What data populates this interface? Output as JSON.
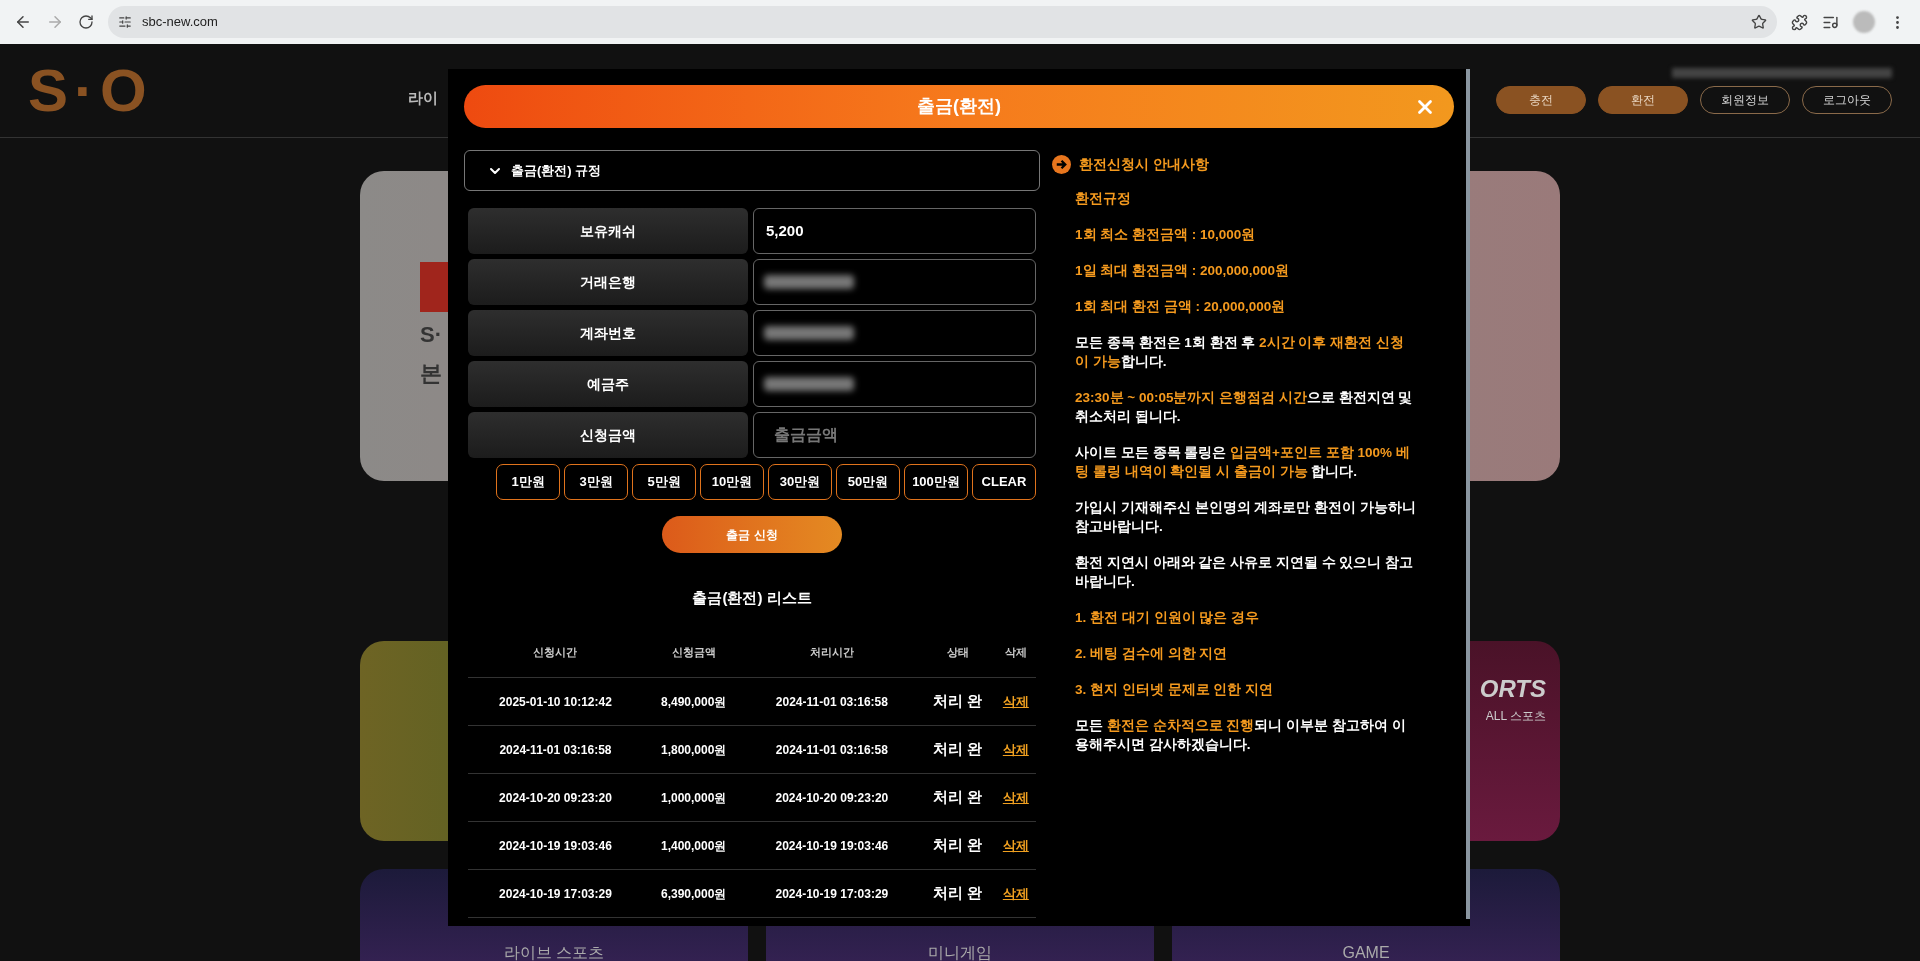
{
  "browser": {
    "url": "sbc-new.com"
  },
  "site": {
    "logo": "S·O",
    "nav_item": "라이",
    "header_buttons": [
      {
        "label": "충전",
        "kind": "filled"
      },
      {
        "label": "환전",
        "kind": "filled"
      },
      {
        "label": "회원정보",
        "kind": "outline"
      },
      {
        "label": "로그아웃",
        "kind": "outline"
      }
    ],
    "hero": {
      "line_1": "S·",
      "line_2": "본"
    },
    "cards": [
      {
        "title": "ORTS",
        "subtitle": "ALL 스포츠"
      }
    ],
    "bottom_cards": [
      {
        "title": "라이브 스포츠"
      },
      {
        "title": "미니게임"
      },
      {
        "title": "GAME"
      }
    ]
  },
  "modal": {
    "title": "출금(환전)",
    "accordion": {
      "label": "출금(환전) 규정",
      "expanded": false
    },
    "fields": [
      {
        "label": "보유캐쉬",
        "kind": "text",
        "value": "5,200"
      },
      {
        "label": "거래은행",
        "kind": "redacted"
      },
      {
        "label": "계좌번호",
        "kind": "redacted"
      },
      {
        "label": "예금주",
        "kind": "redacted"
      },
      {
        "label": "신청금액",
        "kind": "input",
        "placeholder": "출금금액"
      }
    ],
    "amount_buttons": [
      "1만원",
      "3만원",
      "5만원",
      "10만원",
      "30만원",
      "50만원",
      "100만원",
      "CLEAR"
    ],
    "submit": "출금 신청",
    "list_title": "출금(환전) 리스트",
    "table": {
      "columns": [
        "신청시간",
        "신청금액",
        "처리시간",
        "상태",
        "삭제"
      ],
      "rows": [
        {
          "requested": "2025-01-10 10:12:42",
          "amount": "8,490,000원",
          "processed": "2024-11-01 03:16:58",
          "status": "처리 완",
          "action": "삭제"
        },
        {
          "requested": "2024-11-01 03:16:58",
          "amount": "1,800,000원",
          "processed": "2024-11-01 03:16:58",
          "status": "처리 완",
          "action": "삭제"
        },
        {
          "requested": "2024-10-20 09:23:20",
          "amount": "1,000,000원",
          "processed": "2024-10-20 09:23:20",
          "status": "처리 완",
          "action": "삭제"
        },
        {
          "requested": "2024-10-19 19:03:46",
          "amount": "1,400,000원",
          "processed": "2024-10-19 19:03:46",
          "status": "처리 완",
          "action": "삭제"
        },
        {
          "requested": "2024-10-19 17:03:29",
          "amount": "6,390,000원",
          "processed": "2024-10-19 17:03:29",
          "status": "처리 완",
          "action": "삭제"
        }
      ]
    },
    "notice": {
      "heading": "환전신청시 안내사항",
      "paragraphs": [
        [
          {
            "text": "환전규정",
            "highlight": true
          }
        ],
        [
          {
            "text": "1회 최소 환전금액 : 10,000원",
            "highlight": true
          }
        ],
        [
          {
            "text": "1일 최대 환전금액 : 200,000,000원",
            "highlight": true
          }
        ],
        [
          {
            "text": "1회 최대 환전 금액 : 20,000,000원",
            "highlight": true
          }
        ],
        [
          {
            "text": "모든 종목 환전은 1회 환전 후 ",
            "highlight": false
          },
          {
            "text": "2시간 이후 재환전 신청이 가능",
            "highlight": true
          },
          {
            "text": "합니다.",
            "highlight": false
          }
        ],
        [
          {
            "text": "23:30분 ~ 00:05분까지 은행점검 시간",
            "highlight": true
          },
          {
            "text": "으로 환전지연 및 취소처리 됩니다.",
            "highlight": false
          }
        ],
        [
          {
            "text": "사이트 모든 종목 롤링은 ",
            "highlight": false
          },
          {
            "text": "입금액+포인트 포함 100% 베팅 롤링 내역이 확인될 시 출금이 가능",
            "highlight": true
          },
          {
            "text": " 합니다.",
            "highlight": false
          }
        ],
        [
          {
            "text": "가입시 기재해주신 본인명의 계좌로만 환전이 가능하니 참고바랍니다.",
            "highlight": false
          }
        ],
        [
          {
            "text": "환전 지연시 아래와 같은 사유로 지연될 수 있으니 참고바랍니다.",
            "highlight": false
          }
        ],
        [
          {
            "text": "1. 환전 대기 인원이 많은 경우",
            "highlight": true
          }
        ],
        [
          {
            "text": "2. 베팅 검수에 의한 지연",
            "highlight": true
          }
        ],
        [
          {
            "text": "3. 현지 인터넷 문제로 인한 지연",
            "highlight": true
          }
        ],
        [
          {
            "text": "모든 ",
            "highlight": false
          },
          {
            "text": "환전은 순차적으로 진행",
            "highlight": true
          },
          {
            "text": "되니 이부분 참고하여 이용해주시면 감사하겠습니다.",
            "highlight": false
          }
        ]
      ]
    }
  }
}
